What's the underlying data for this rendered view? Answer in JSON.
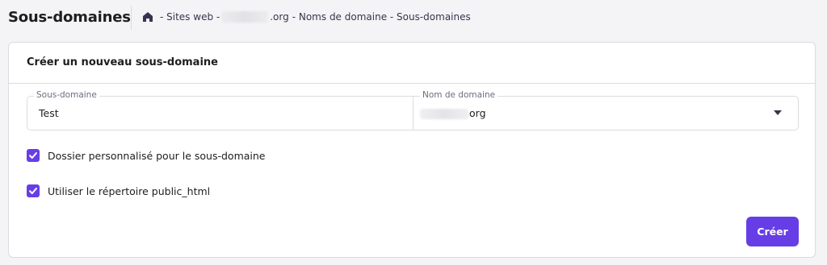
{
  "header": {
    "title": "Sous-domaines",
    "breadcrumb": {
      "home_icon": "home-icon",
      "sep1": "- Sites web -",
      "domain_suffix": ".org",
      "sep2": "- Noms de domaine - Sous-domaines"
    }
  },
  "card": {
    "title": "Créer un nouveau sous-domaine",
    "subdomain_field": {
      "label": "Sous-domaine",
      "value": "Test"
    },
    "domain_field": {
      "label": "Nom de domaine",
      "value_suffix": "org",
      "icon": "caret-down-icon"
    },
    "checkboxes": [
      {
        "label": "Dossier personnalisé pour le sous-domaine",
        "checked": true
      },
      {
        "label": "Utiliser le répertoire public_html",
        "checked": true
      }
    ],
    "submit_label": "Créer",
    "accent_color": "#673de6"
  }
}
